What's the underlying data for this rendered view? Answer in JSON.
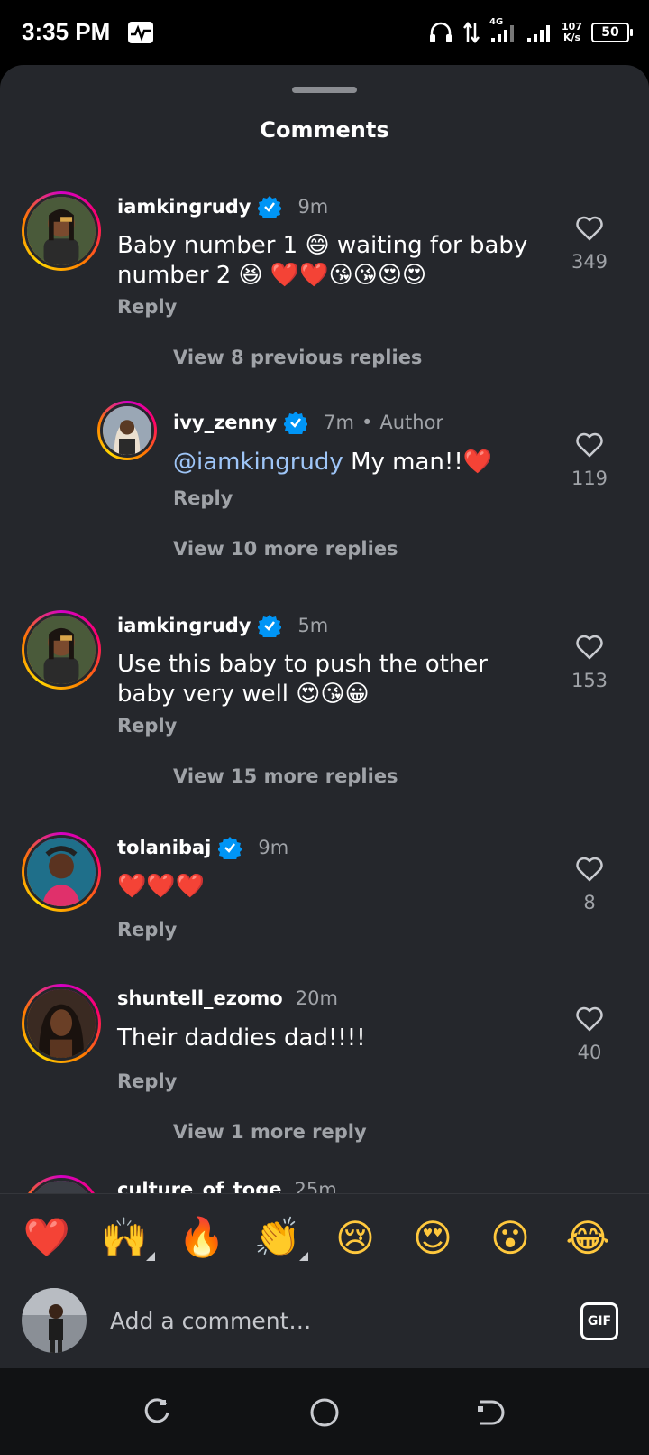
{
  "status_bar": {
    "time": "3:35 PM",
    "network": "4G",
    "speed_value": "107",
    "speed_unit": "K/s",
    "battery": "50"
  },
  "sheet": {
    "title": "Comments"
  },
  "comments": [
    {
      "username": "iamkingrudy",
      "verified": true,
      "time": "9m",
      "text": "Baby number 1 😄 waiting for baby number 2 😆 ❤️❤️😘😘😍😍",
      "reply_label": "Reply",
      "likes": "349",
      "view_more": "View 8 previous replies"
    },
    {
      "username": "ivy_zenny",
      "verified": true,
      "time": "7m",
      "author_tag": "Author",
      "mention": "@iamkingrudy",
      "text": "My man!!❤️",
      "reply_label": "Reply",
      "likes": "119",
      "view_more": "View 10 more replies"
    },
    {
      "username": "iamkingrudy",
      "verified": true,
      "time": "5m",
      "text": "Use this baby to push the other baby very well 😍😘😀",
      "reply_label": "Reply",
      "likes": "153",
      "view_more": "View 15 more replies"
    },
    {
      "username": "tolanibaj",
      "verified": true,
      "time": "9m",
      "text": "❤️❤️❤️",
      "reply_label": "Reply",
      "likes": "8"
    },
    {
      "username": "shuntell_ezomo",
      "verified": false,
      "time": "20m",
      "text": "Their daddies dad!!!!",
      "reply_label": "Reply",
      "likes": "40",
      "view_more": "View 1 more reply"
    },
    {
      "username": "culture_of_toge",
      "time": "25m"
    }
  ],
  "quick_emojis": [
    "❤️",
    "🙌",
    "🔥",
    "👏",
    "😢",
    "😍",
    "😮",
    "😂"
  ],
  "composer": {
    "placeholder": "Add a comment…",
    "gif_label": "GIF"
  },
  "colors": {
    "sheet_bg": "#25272c",
    "muted_text": "#a0a3a8",
    "mention": "#9ec5f7",
    "verified": "#0095f6"
  }
}
